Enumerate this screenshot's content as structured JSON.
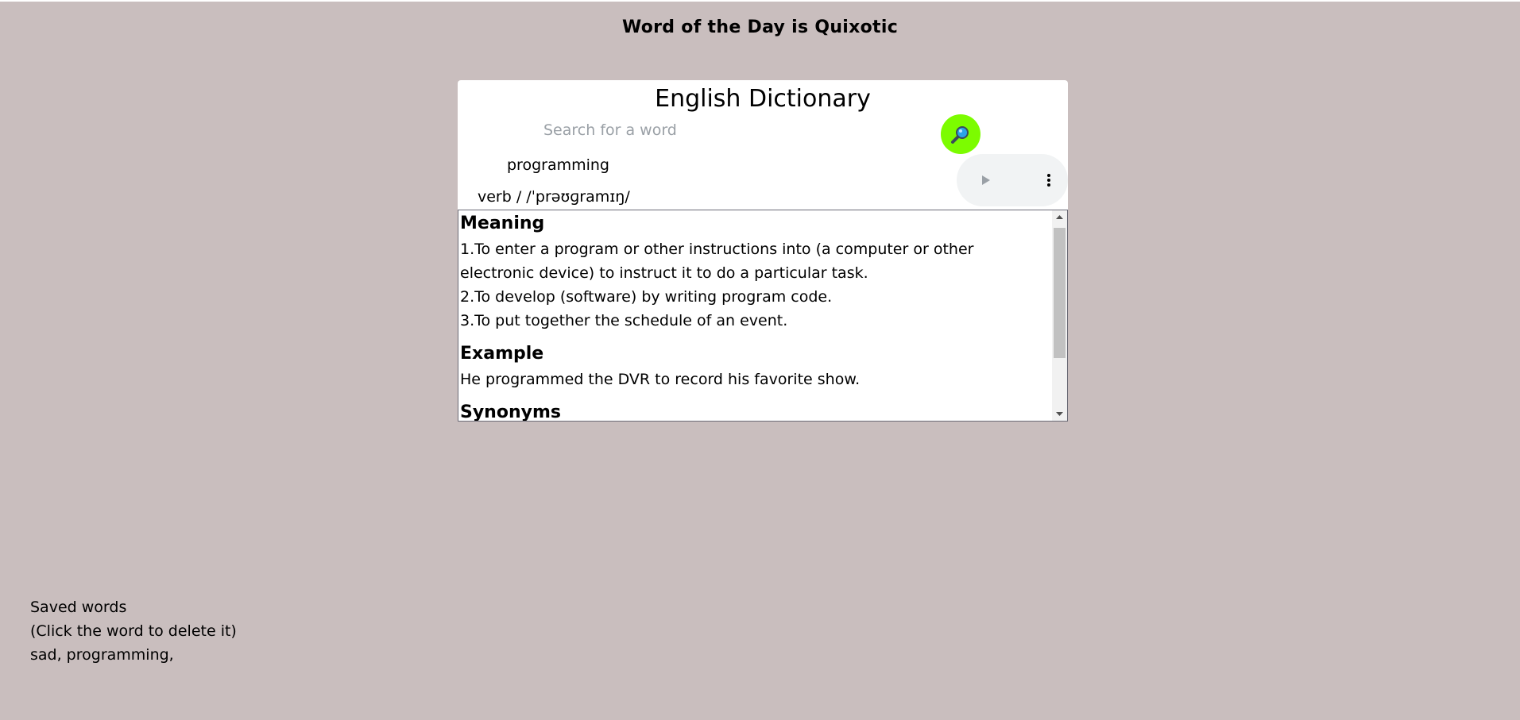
{
  "word_of_day": "Word of the Day is Quixotic",
  "card": {
    "title": "English Dictionary",
    "search_placeholder": "Search for a word",
    "search_icon": "magnifier-icon",
    "word": "programming",
    "part_of_speech": "verb / /ˈprəʊɡramɪŋ/",
    "audio": {
      "play_icon": "play-icon",
      "more_icon": "more-vert-icon"
    }
  },
  "details": {
    "meaning_heading": "Meaning",
    "meanings": [
      "1.To enter a program or other instructions into (a computer or other electronic device) to instruct it to do a particular task.",
      "2.To develop (software) by writing program code.",
      "3.To put together the schedule of an event."
    ],
    "example_heading": "Example",
    "example": "He programmed the DVR to record his favorite show.",
    "synonyms_heading": "Synonyms"
  },
  "saved": {
    "title": "Saved words",
    "hint": "(Click the word to delete it)",
    "words": "sad, programming,"
  },
  "colors": {
    "background": "#c9bebe",
    "search_button": "#7cfc00"
  }
}
